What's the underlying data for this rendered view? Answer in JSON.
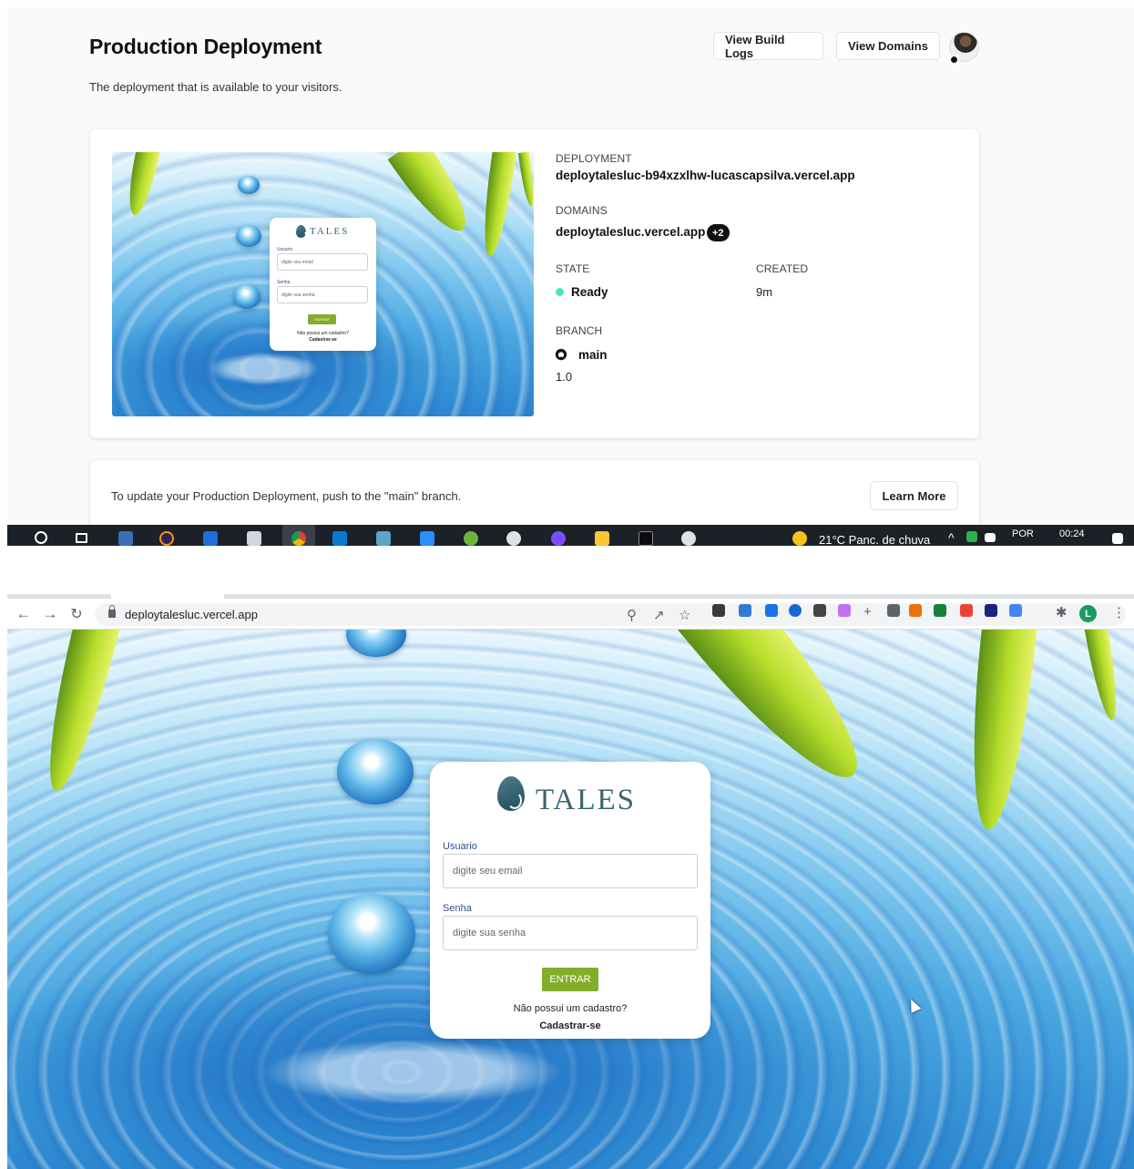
{
  "vercel": {
    "title": "Production Deployment",
    "subtitle": "The deployment that is available to your visitors.",
    "view_build_logs": "View Build Logs",
    "view_domains": "View Domains",
    "deployment_label": "DEPLOYMENT",
    "deployment_url": "deploytalesluc-b94xzxlhw-lucascapsilva.vercel.app",
    "domains_label": "DOMAINS",
    "domain": "deploytalesluc.vercel.app",
    "domains_extra": "+2",
    "state_label": "STATE",
    "state_value": "Ready",
    "created_label": "CREATED",
    "created_value": "9m",
    "branch_label": "BRANCH",
    "branch_value": "main",
    "commit_message": "1.0",
    "update_text": "To update your Production Deployment, push to the \"main\" branch.",
    "learn_more": "Learn More",
    "status_color": "#50e3c2"
  },
  "taskbar": {
    "weather": "21°C  Panc. de chuva",
    "language": "POR",
    "time": "00:24",
    "icons": [
      "search-icon",
      "task-view-icon",
      "vs-icon",
      "eclipse-icon",
      "store-icon",
      "app-icon",
      "chrome-icon",
      "vscode-icon",
      "pen-icon",
      "zoom-icon",
      "spring-icon",
      "slack-icon",
      "messenger-icon",
      "folder-icon",
      "terminal-icon",
      "paint-icon"
    ]
  },
  "browser": {
    "url": "deploytalesluc.vercel.app",
    "profile_initial": "L"
  },
  "login": {
    "brand": "TALES",
    "user_label": "Usuario",
    "user_placeholder": "digite seu email",
    "pass_label": "Senha",
    "pass_placeholder": "digite sua senha",
    "submit": "ENTRAR",
    "question": "Não possui um cadastro?",
    "register": "Cadastrar-se",
    "button_color": "#83ad2a"
  }
}
